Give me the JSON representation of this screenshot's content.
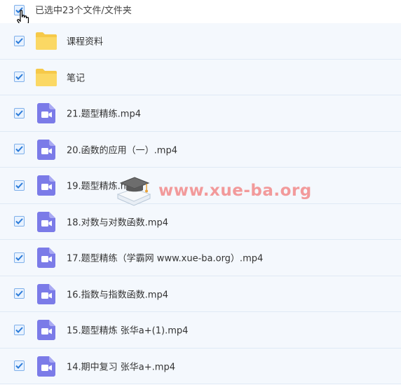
{
  "header": {
    "selection_text": "已选中23个文件/文件夹"
  },
  "files": [
    {
      "name": "课程资料",
      "type": "folder",
      "checked": true
    },
    {
      "name": "笔记",
      "type": "folder",
      "checked": true
    },
    {
      "name": "21.题型精练.mp4",
      "type": "video",
      "checked": true
    },
    {
      "name": "20.函数的应用（一）.mp4",
      "type": "video",
      "checked": true
    },
    {
      "name": "19.题型精炼.mp4",
      "type": "video",
      "checked": true
    },
    {
      "name": "18.对数与对数函数.mp4",
      "type": "video",
      "checked": true
    },
    {
      "name": "17.题型精练（学霸网 www.xue-ba.org）.mp4",
      "type": "video",
      "checked": true
    },
    {
      "name": "16.指数与指数函数.mp4",
      "type": "video",
      "checked": true
    },
    {
      "name": "15.题型精炼 张华a+(1).mp4",
      "type": "video",
      "checked": true
    },
    {
      "name": "14.期中复习 张华a+.mp4",
      "type": "video",
      "checked": true
    }
  ],
  "watermark": {
    "text": "www.xue-ba.org",
    "icon": "graduation-cap-book-icon"
  },
  "icons": {
    "folder": "folder-icon",
    "video": "video-file-icon",
    "check": "checkmark-icon",
    "cursor": "hand-pointer-icon"
  },
  "colors": {
    "folder": "#f9d25c",
    "video": "#7b7be8",
    "check": "#2b7bd8",
    "row_bg": "#f4f8fd",
    "watermark": "#f28a8a"
  }
}
